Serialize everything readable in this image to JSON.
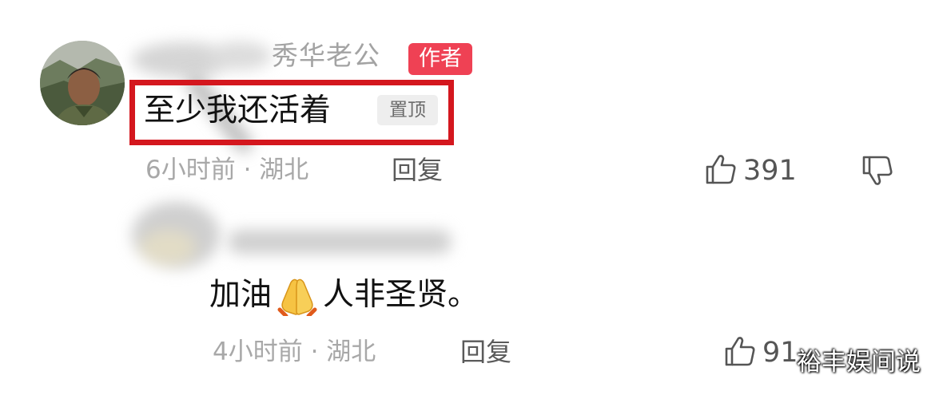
{
  "comments": [
    {
      "username": "秀华老公",
      "author_badge": "作者",
      "text": "至少我还活着",
      "pin_badge": "置顶",
      "meta": "6小时前 · 湖北",
      "reply_label": "回复",
      "likes": "391"
    }
  ],
  "replies": [
    {
      "text_before": "加油",
      "emoji": "folded-hands-emoji",
      "text_after": "人非圣贤。",
      "meta": "4小时前 · 湖北",
      "reply_label": "回复",
      "likes": "91"
    }
  ],
  "watermark": "裕丰娱间说",
  "colors": {
    "author_badge": "#ef4154",
    "highlight_border": "#d4171e",
    "meta_text": "#a8a8a8"
  }
}
